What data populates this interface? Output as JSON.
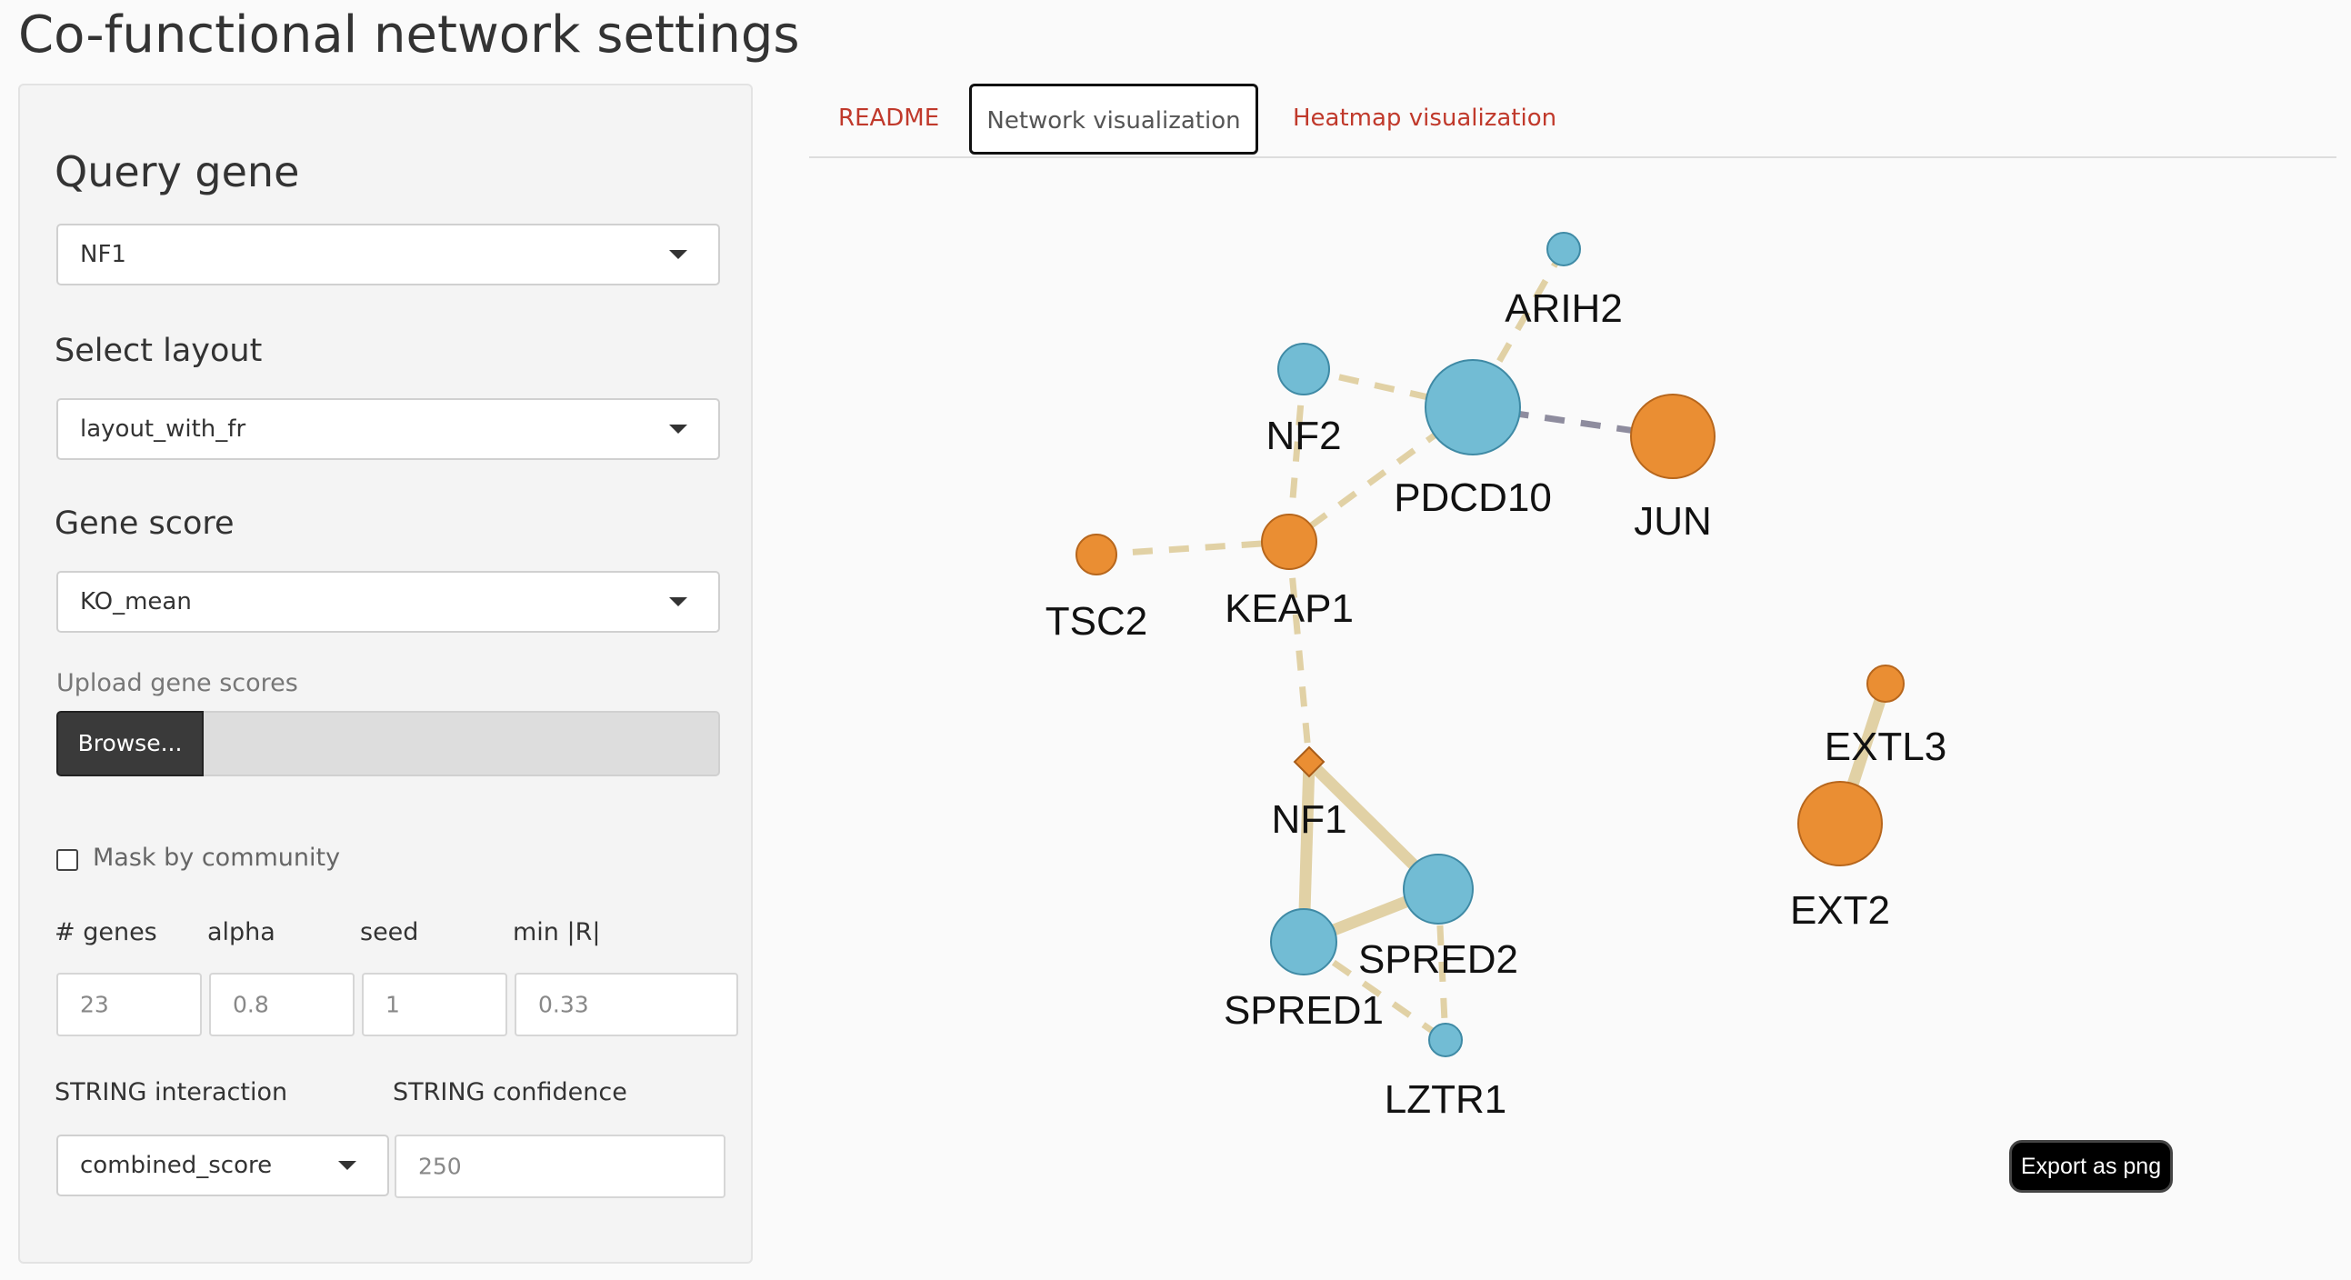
{
  "page": {
    "title": "Co-functional network settings"
  },
  "sidebar": {
    "query_gene": {
      "label": "Query gene",
      "value": "NF1"
    },
    "layout": {
      "label": "Select layout",
      "value": "layout_with_fr"
    },
    "gene_score": {
      "label": "Gene score",
      "value": "KO_mean"
    },
    "upload": {
      "label": "Upload gene scores",
      "button": "Browse..."
    },
    "mask": {
      "label": "Mask by community",
      "checked": false
    },
    "params": {
      "genes": {
        "label": "# genes",
        "value": "23"
      },
      "alpha": {
        "label": "alpha",
        "value": "0.8"
      },
      "seed": {
        "label": "seed",
        "value": "1"
      },
      "min_r": {
        "label": "min |R|",
        "value": "0.33"
      }
    },
    "string_interaction": {
      "label": "STRING interaction",
      "value": "combined_score"
    },
    "string_confidence": {
      "label": "STRING confidence",
      "value": "250"
    }
  },
  "tabs": [
    {
      "label": "README",
      "active": false
    },
    {
      "label": "Network visualization",
      "active": true
    },
    {
      "label": "Heatmap visualization",
      "active": false
    }
  ],
  "network": {
    "colors": {
      "blue_node": "#72bcd4",
      "orange_node": "#ea8e33",
      "edge_positive": "#e1d1a5",
      "edge_negative": "#8e8c9e"
    },
    "nodes": [
      {
        "id": "ARIH2",
        "label": "ARIH2",
        "color": "blue",
        "shape": "circle"
      },
      {
        "id": "PDCD10",
        "label": "PDCD10",
        "color": "blue",
        "shape": "circle"
      },
      {
        "id": "NF2",
        "label": "NF2",
        "color": "blue",
        "shape": "circle"
      },
      {
        "id": "JUN",
        "label": "JUN",
        "color": "orange",
        "shape": "circle"
      },
      {
        "id": "KEAP1",
        "label": "KEAP1",
        "color": "orange",
        "shape": "circle"
      },
      {
        "id": "TSC2",
        "label": "TSC2",
        "color": "orange",
        "shape": "circle"
      },
      {
        "id": "NF1",
        "label": "NF1",
        "color": "orange",
        "shape": "diamond"
      },
      {
        "id": "SPRED2",
        "label": "SPRED2",
        "color": "blue",
        "shape": "circle"
      },
      {
        "id": "SPRED1",
        "label": "SPRED1",
        "color": "blue",
        "shape": "circle"
      },
      {
        "id": "LZTR1",
        "label": "LZTR1",
        "color": "blue",
        "shape": "circle"
      },
      {
        "id": "EXTL3",
        "label": "EXTL3",
        "color": "orange",
        "shape": "circle"
      },
      {
        "id": "EXT2",
        "label": "EXT2",
        "color": "orange",
        "shape": "circle"
      }
    ],
    "edges": [
      {
        "source": "ARIH2",
        "target": "PDCD10",
        "style": "dashed",
        "sign": "positive"
      },
      {
        "source": "NF2",
        "target": "PDCD10",
        "style": "dashed",
        "sign": "positive"
      },
      {
        "source": "PDCD10",
        "target": "JUN",
        "style": "dashed",
        "sign": "negative"
      },
      {
        "source": "PDCD10",
        "target": "KEAP1",
        "style": "dashed",
        "sign": "positive"
      },
      {
        "source": "NF2",
        "target": "KEAP1",
        "style": "dashed",
        "sign": "positive"
      },
      {
        "source": "TSC2",
        "target": "KEAP1",
        "style": "dashed",
        "sign": "positive"
      },
      {
        "source": "KEAP1",
        "target": "NF1",
        "style": "dashed",
        "sign": "positive"
      },
      {
        "source": "NF1",
        "target": "SPRED2",
        "style": "solid",
        "sign": "positive"
      },
      {
        "source": "NF1",
        "target": "SPRED1",
        "style": "solid",
        "sign": "positive"
      },
      {
        "source": "SPRED1",
        "target": "SPRED2",
        "style": "solid",
        "sign": "positive"
      },
      {
        "source": "SPRED2",
        "target": "LZTR1",
        "style": "dashed",
        "sign": "positive"
      },
      {
        "source": "SPRED1",
        "target": "LZTR1",
        "style": "dashed",
        "sign": "positive"
      },
      {
        "source": "EXTL3",
        "target": "EXT2",
        "style": "solid",
        "sign": "positive"
      }
    ],
    "export_label": "Export as png"
  }
}
